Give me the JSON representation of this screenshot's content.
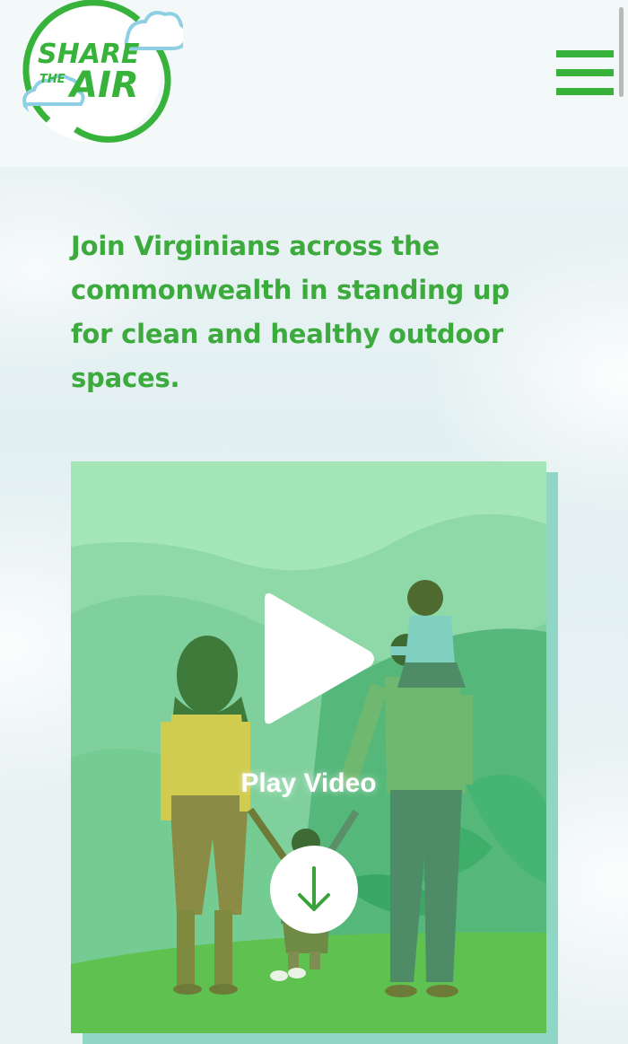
{
  "header": {
    "logo": {
      "word_top": "SHARE",
      "word_small": "THE",
      "word_bottom": "AIR"
    },
    "menu_icon": "hamburger-menu-icon"
  },
  "intro": {
    "text": "Join Virginians across the commonwealth in standing up for clean and healthy outdoor spaces."
  },
  "video": {
    "play_label": "Play Video",
    "play_icon": "play-icon",
    "scroll_icon": "arrow-down-icon"
  },
  "colors": {
    "brand_green": "#3daa3d",
    "menu_green": "#37b33b",
    "cloud_blue": "#8ecfe3",
    "card_light": "#a5e6b8"
  }
}
